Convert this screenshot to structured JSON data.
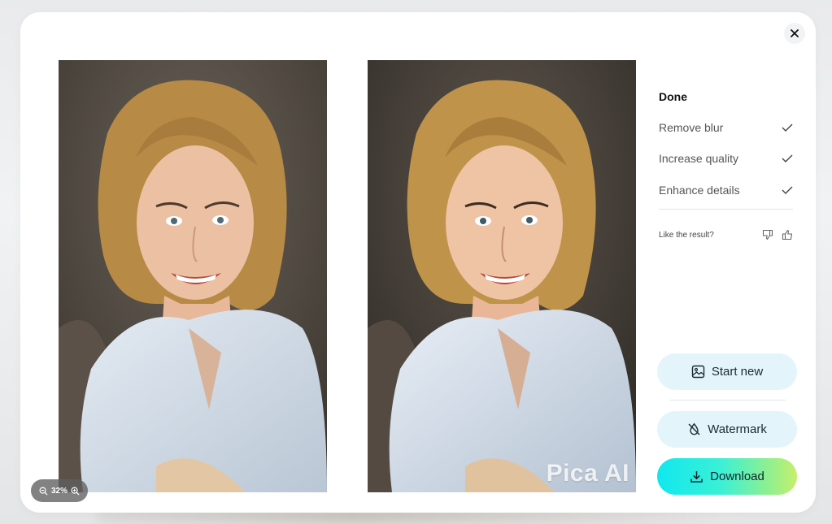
{
  "viewer": {
    "zoom_label": "32%",
    "watermark_text": "Pica AI"
  },
  "panel": {
    "status_title": "Done",
    "steps": [
      {
        "label": "Remove blur",
        "done": true
      },
      {
        "label": "Increase quality",
        "done": true
      },
      {
        "label": "Enhance details",
        "done": true
      }
    ],
    "feedback_label": "Like the result?"
  },
  "actions": {
    "start_new": "Start new",
    "watermark": "Watermark",
    "download": "Download"
  },
  "colors": {
    "accent_gradient_start": "#10e8ee",
    "accent_gradient_end": "#c6ef6b",
    "secondary_button": "#e3f5fb"
  },
  "icons": {
    "close": "close-icon",
    "zoom_out": "zoom-out-icon",
    "zoom_in": "zoom-in-icon",
    "check": "check-icon",
    "thumbs_down": "thumbs-down-icon",
    "thumbs_up": "thumbs-up-icon",
    "image": "image-icon",
    "no_watermark": "no-watermark-icon",
    "download": "download-icon"
  }
}
